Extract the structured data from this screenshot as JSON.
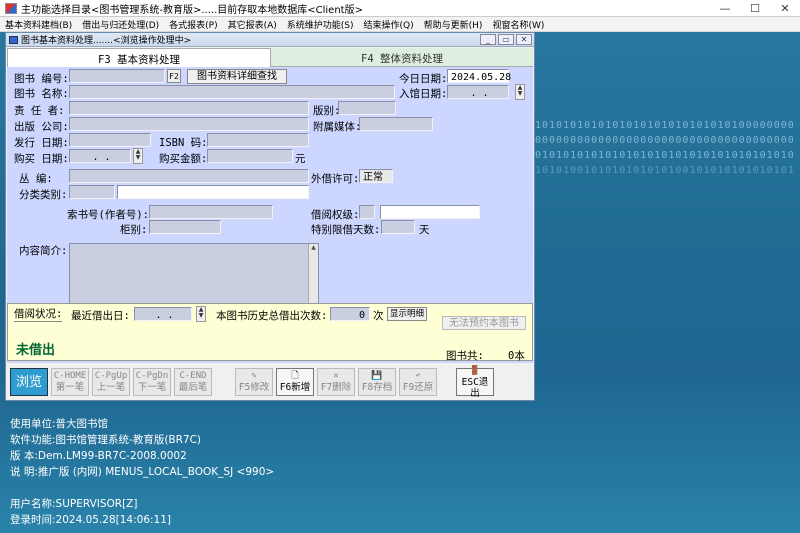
{
  "app_title": "主功能选择目录<图书管理系统-教育版>.....目前存取本地数据库<Client版>",
  "menu": [
    "基本资料建档(B)",
    "借出与归还处理(D)",
    "各式报表(P)",
    "其它报表(A)",
    "系统维护功能(S)",
    "结束操作(Q)",
    "帮助与更新(H)",
    "视窗名称(W)"
  ],
  "window": {
    "title": "图书基本资料处理.......<浏览操作处理中>",
    "tabs": {
      "basic": "F3 基本资料处理",
      "overall": "F4 整体资料处理"
    }
  },
  "form": {
    "book_no": "图书 编号:",
    "f2": "F2",
    "detail_query": "图书资料详细查找",
    "today_label": "今日日期:",
    "today_value": "2024.05.28",
    "book_name": "图书 名称:",
    "entry_date": "入馆日期:",
    "entry_date_value": ". .",
    "author": "责  任  者:",
    "edition": "版别:",
    "publisher": "出版 公司:",
    "media": "附属媒体:",
    "pub_date": "发行 日期:",
    "isbn": "ISBN  码:",
    "buy_date": "购买  日期:",
    "buy_date_value": ". .",
    "buy_amount": "购买金额:",
    "currency": "元",
    "series": "丛      编:",
    "lend_permit": "外借许可:",
    "lend_permit_value": "正常",
    "category": "分类类别:",
    "call_no": "索书号(作者号):",
    "borrow_level": "借阅权级:",
    "column": "柜别:",
    "special_days": "特别限借天数:",
    "days_unit": "天",
    "summary": "内容简介:"
  },
  "status": {
    "label": "借阅状况:",
    "recent_label": "最近借出日:",
    "recent_value": ". .",
    "history_label": "本图书历史总借出次数:",
    "history_value": "0",
    "times_unit": "次",
    "show_detail": "显示明细",
    "reserve": "无法预约本图书",
    "total_label": "图书共:",
    "total_value": "0本",
    "state": "未借出"
  },
  "toolbar": [
    {
      "label": "浏览",
      "icon": "",
      "name": "browse-button",
      "cls": "browse"
    },
    {
      "label": "第一笔",
      "icon": "C-HOME",
      "name": "first-record-button",
      "cls": ""
    },
    {
      "label": "上一笔",
      "icon": "C-PgUp",
      "name": "prev-record-button",
      "cls": ""
    },
    {
      "label": "下一笔",
      "icon": "C-PgDn",
      "name": "next-record-button",
      "cls": ""
    },
    {
      "label": "最后笔",
      "icon": "C-END",
      "name": "last-record-button",
      "cls": ""
    },
    {
      "label": "F5修改",
      "icon": "✎",
      "name": "edit-button",
      "cls": ""
    },
    {
      "label": "F6新增",
      "icon": "🗋",
      "name": "add-button",
      "cls": "on"
    },
    {
      "label": "F7删除",
      "icon": "✕",
      "name": "delete-button",
      "cls": ""
    },
    {
      "label": "F8存档",
      "icon": "💾",
      "name": "save-button",
      "cls": ""
    },
    {
      "label": "F9还原",
      "icon": "↶",
      "name": "restore-button",
      "cls": ""
    },
    {
      "label": "ESC退出",
      "icon": "🚪",
      "name": "exit-button",
      "cls": "on"
    }
  ],
  "info": [
    "使用单位:普大图书馆",
    "软件功能:图书馆管理系统-教育版(BR7C)",
    "版    本:Dem.LM99-BR7C-2008.0002",
    "说    明:推广版 (内网) MENUS_LOCAL_BOOK_SJ <990>",
    "",
    "用户名称:SUPERVISOR[Z]",
    "登录时间:2024.05.28[14:06:11]"
  ],
  "binary": [
    "1010101010101010101010101010100000000",
    "0000000000000000000000000000000000000",
    "0101010101010101010101010101010101010",
    "1010100101010101010100101010101010101"
  ]
}
